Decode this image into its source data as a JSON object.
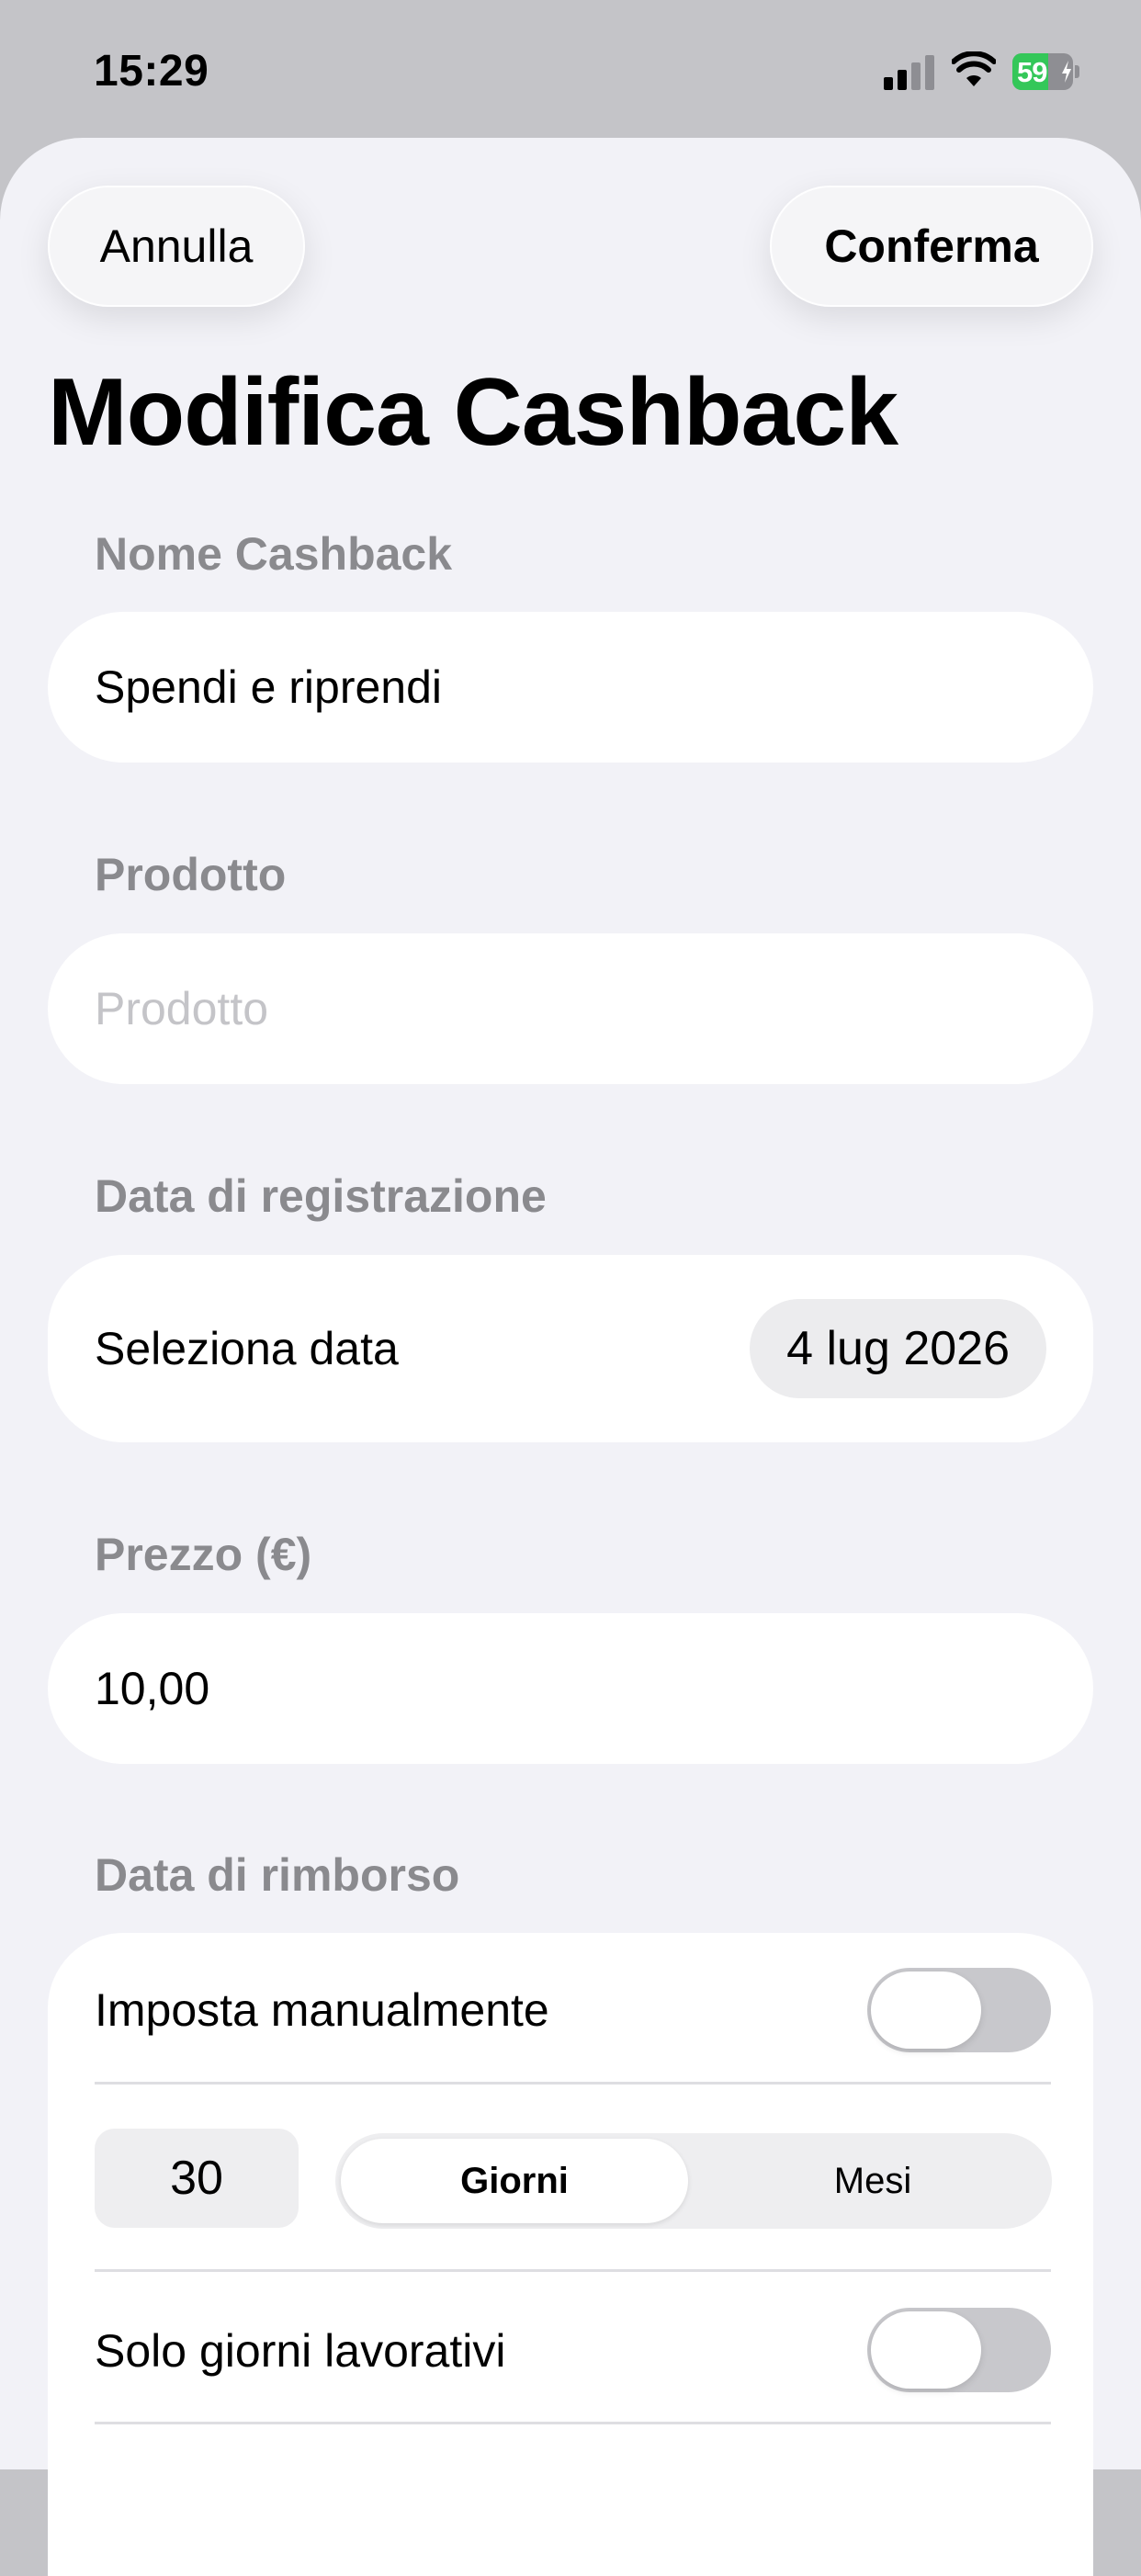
{
  "status_bar": {
    "time": "15:29",
    "battery_percent": "59",
    "battery_level": 0.59,
    "battery_color": "#34c759",
    "icons": [
      "cellular-signal-icon",
      "wifi-icon",
      "battery-icon",
      "charging-bolt-icon"
    ]
  },
  "nav": {
    "cancel_label": "Annulla",
    "confirm_label": "Conferma"
  },
  "page": {
    "title": "Modifica Cashback"
  },
  "form": {
    "name": {
      "label": "Nome Cashback",
      "value": "Spendi e riprendi"
    },
    "product": {
      "label": "Prodotto",
      "value": "",
      "placeholder": "Prodotto"
    },
    "registration_date": {
      "label": "Data di registrazione",
      "row_label": "Seleziona data",
      "value": "4 lug 2026"
    },
    "price": {
      "label": "Prezzo (€)",
      "value": "10,00"
    },
    "refund": {
      "label": "Data di rimborso",
      "manual_label": "Imposta manualmente",
      "manual_enabled": false,
      "amount": "30",
      "unit_options": [
        "Giorni",
        "Mesi"
      ],
      "unit_selected": "Giorni",
      "business_days_label": "Solo giorni lavorativi",
      "business_days_enabled": false
    }
  },
  "colors": {
    "sheet_background": "#f2f2f7",
    "field_background": "#ffffff",
    "label_gray": "#8a8a8e",
    "toggle_off": "#c8c8cc"
  }
}
